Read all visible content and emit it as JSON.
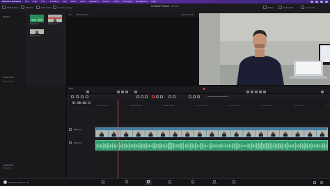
{
  "app": {
    "name": "DaVinci Resolve",
    "version_label": "DaVinci Resolve 18",
    "project_title": "Untitled Project",
    "edited_label": "Edited"
  },
  "menubar": {
    "items": [
      "DaVinci Resolve",
      "File",
      "Edit",
      "Trim",
      "Timeline",
      "Clip",
      "Mark",
      "View",
      "Playback",
      "Fusion",
      "Color",
      "Fairlight",
      "Workspace",
      "Help"
    ]
  },
  "toolbar": {
    "media_pool_label": "Media Pool",
    "effects_label": "Effects",
    "edit_index_label": "Edit Index",
    "sound_library_label": "Sound Library",
    "inspector_label": "Inspector",
    "mixer_label": "Mixer",
    "metadata_label": "Metadata"
  },
  "media_pool": {
    "bins_title": "Master",
    "smart_bins_label": "Smart Bins",
    "keywords_label": "Keywords",
    "clips": [
      {
        "name": "Timeline 1"
      },
      {
        "name": "Clip 01.mov"
      },
      {
        "name": "Clip 02.mov"
      }
    ]
  },
  "source_viewer": {
    "zoom": "Fit",
    "clip_name": "",
    "timecode": "00:00:00:00"
  },
  "timeline_viewer": {
    "zoom": "Fit",
    "timeline_name": "Timeline 1",
    "timecode": "01:00:06:22"
  },
  "timeline": {
    "timecode": "01:00:06:22",
    "ruler_ticks": [
      "01:00:00:00",
      "01:00:04:00",
      "01:00:08:00",
      "01:00:12:00",
      "01:00:16:00",
      "01:00:20:00",
      "01:00:24:00",
      "01:00:28:00"
    ],
    "video_track_label": "Video 1",
    "audio_track_label": "Audio 1",
    "video_track_id": "V1",
    "audio_track_id": "A1",
    "clip_name": "Clip 01.mov"
  },
  "pages": [
    {
      "label": "Media"
    },
    {
      "label": "Cut"
    },
    {
      "label": "Edit",
      "active": true
    },
    {
      "label": "Fusion"
    },
    {
      "label": "Color"
    },
    {
      "label": "Fairlight"
    },
    {
      "label": "Deliver"
    }
  ],
  "colors": {
    "menubar_accent": "#5a2da0",
    "video_clip": "#3e7fa3",
    "audio_clip": "#2f9a6a",
    "playhead": "#e0463b"
  }
}
